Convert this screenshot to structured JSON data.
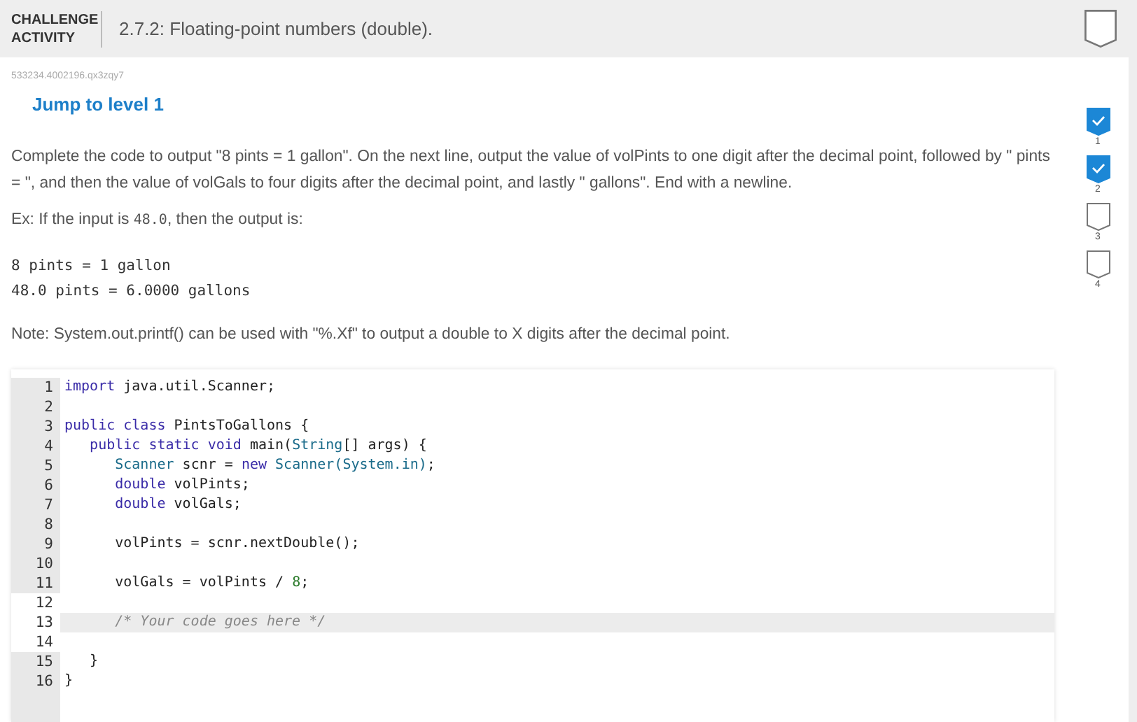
{
  "header": {
    "label": "CHALLENGE ACTIVITY",
    "title": "2.7.2: Floating-point numbers (double)."
  },
  "activity_id": "533234.4002196.qx3zqy7",
  "jump_link": "Jump to level 1",
  "levels": [
    {
      "number": "1",
      "completed": true
    },
    {
      "number": "2",
      "completed": true
    },
    {
      "number": "3",
      "completed": false
    },
    {
      "number": "4",
      "completed": false
    }
  ],
  "instructions": "Complete the code to output \"8 pints = 1 gallon\". On the next line, output the value of volPints to one digit after the decimal point, followed by \" pints = \", and then the value of volGals to four digits after the decimal point, and lastly \" gallons\". End with a newline.",
  "example": {
    "before": "Ex: If the input is ",
    "input": "48.0",
    "after": ", then the output is:"
  },
  "expected_output": [
    "8 pints = 1 gallon",
    "48.0 pints = 6.0000 gallons"
  ],
  "note": "Note: System.out.printf() can be used with \"%.Xf\" to output a double to X digits after the decimal point.",
  "code_lines": [
    {
      "number": "1",
      "editable": false,
      "active": false,
      "tokens": [
        {
          "kind": "keyword",
          "text": "import"
        },
        {
          "kind": "plain",
          "text": " java.util.Scanner;"
        }
      ]
    },
    {
      "number": "2",
      "editable": false,
      "active": false
    },
    {
      "number": "3",
      "editable": false,
      "active": false,
      "tokens": [
        {
          "kind": "keyword",
          "text": "public class"
        },
        {
          "kind": "plain",
          "text": " PintsToGallons {"
        }
      ]
    },
    {
      "number": "4",
      "editable": false,
      "active": false,
      "tokens": [
        {
          "kind": "keyword",
          "text": "   public static void"
        },
        {
          "kind": "plain",
          "text": " main("
        },
        {
          "kind": "type",
          "text": "String"
        },
        {
          "kind": "plain",
          "text": "[] args) {"
        }
      ]
    },
    {
      "number": "5",
      "editable": false,
      "active": false,
      "tokens": [
        {
          "kind": "type",
          "text": "      Scanner"
        },
        {
          "kind": "plain",
          "text": " scnr = "
        },
        {
          "kind": "keyword",
          "text": "new"
        },
        {
          "kind": "type",
          "text": " Scanner(System.in)"
        },
        {
          "kind": "plain",
          "text": ";"
        }
      ]
    },
    {
      "number": "6",
      "editable": false,
      "active": false,
      "tokens": [
        {
          "kind": "keyword",
          "text": "      double"
        },
        {
          "kind": "plain",
          "text": " volPints;"
        }
      ]
    },
    {
      "number": "7",
      "editable": false,
      "active": false,
      "tokens": [
        {
          "kind": "keyword",
          "text": "      double"
        },
        {
          "kind": "plain",
          "text": " volGals;"
        }
      ]
    },
    {
      "number": "8",
      "editable": false,
      "active": false
    },
    {
      "number": "9",
      "editable": false,
      "active": false,
      "tokens": [
        {
          "kind": "plain",
          "text": "      volPints = scnr.nextDouble();"
        }
      ]
    },
    {
      "number": "10",
      "editable": false,
      "active": false
    },
    {
      "number": "11",
      "editable": false,
      "active": false,
      "tokens": [
        {
          "kind": "plain",
          "text": "      volGals = volPints / "
        },
        {
          "kind": "number",
          "text": "8"
        },
        {
          "kind": "plain",
          "text": ";"
        }
      ]
    },
    {
      "number": "12",
      "editable": true,
      "active": false
    },
    {
      "number": "13",
      "editable": true,
      "active": true,
      "tokens": [
        {
          "kind": "comment",
          "text": "      /* Your code goes here */"
        }
      ]
    },
    {
      "number": "14",
      "editable": true,
      "active": false
    },
    {
      "number": "15",
      "editable": false,
      "active": false,
      "tokens": [
        {
          "kind": "plain",
          "text": "   }"
        }
      ]
    },
    {
      "number": "16",
      "editable": false,
      "active": false,
      "tokens": [
        {
          "kind": "plain",
          "text": "}"
        }
      ]
    }
  ]
}
